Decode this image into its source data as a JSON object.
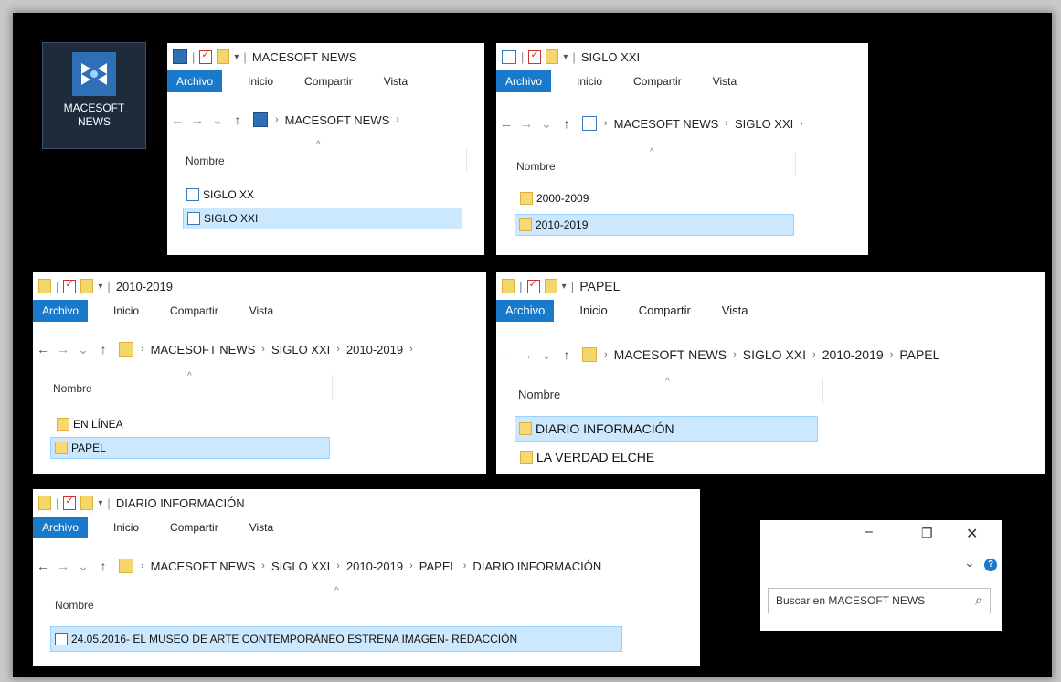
{
  "desktop_icon": {
    "label": "MACESOFT\nNEWS"
  },
  "ribbon": {
    "archivo": "Archivo",
    "inicio": "Inicio",
    "compartir": "Compartir",
    "vista": "Vista"
  },
  "column_header": "Nombre",
  "windows": [
    {
      "title": "MACESOFT NEWS",
      "path": [
        "MACESOFT NEWS"
      ],
      "items": [
        {
          "name": "SIGLO XX",
          "icon": "calendar-folder-icon",
          "selected": false
        },
        {
          "name": "SIGLO XXI",
          "icon": "calendar-folder-icon",
          "selected": true
        }
      ]
    },
    {
      "title": "SIGLO XXI",
      "path": [
        "MACESOFT NEWS",
        "SIGLO XXI"
      ],
      "items": [
        {
          "name": "2000-2009",
          "icon": "folder-icon",
          "selected": false
        },
        {
          "name": "2010-2019",
          "icon": "folder-icon",
          "selected": true
        }
      ]
    },
    {
      "title": "2010-2019",
      "path": [
        "MACESOFT NEWS",
        "SIGLO XXI",
        "2010-2019"
      ],
      "items": [
        {
          "name": "EN LÍNEA",
          "icon": "folder-icon",
          "selected": false
        },
        {
          "name": "PAPEL",
          "icon": "folder-icon",
          "selected": true
        }
      ]
    },
    {
      "title": "PAPEL",
      "path": [
        "MACESOFT NEWS",
        "SIGLO XXI",
        "2010-2019",
        "PAPEL"
      ],
      "items": [
        {
          "name": "DIARIO INFORMACIÓN",
          "icon": "folder-icon",
          "selected": true
        },
        {
          "name": "LA VERDAD ELCHE",
          "icon": "folder-icon",
          "selected": false
        }
      ]
    },
    {
      "title": "DIARIO INFORMACIÓN",
      "path": [
        "MACESOFT NEWS",
        "SIGLO XXI",
        "2010-2019",
        "PAPEL",
        "DIARIO INFORMACIÓN"
      ],
      "items": [
        {
          "name": "24.05.2016- EL MUSEO DE ARTE CONTEMPORÁNEO ESTRENA IMAGEN- REDACCIÓN",
          "icon": "pdf-file-icon",
          "selected": true
        }
      ]
    }
  ],
  "search": {
    "placeholder": "Buscar en MACESOFT NEWS"
  },
  "window_controls": {
    "minimize": "–",
    "restore": "❐",
    "close": "✕",
    "expand": "⌄",
    "help": "?"
  }
}
